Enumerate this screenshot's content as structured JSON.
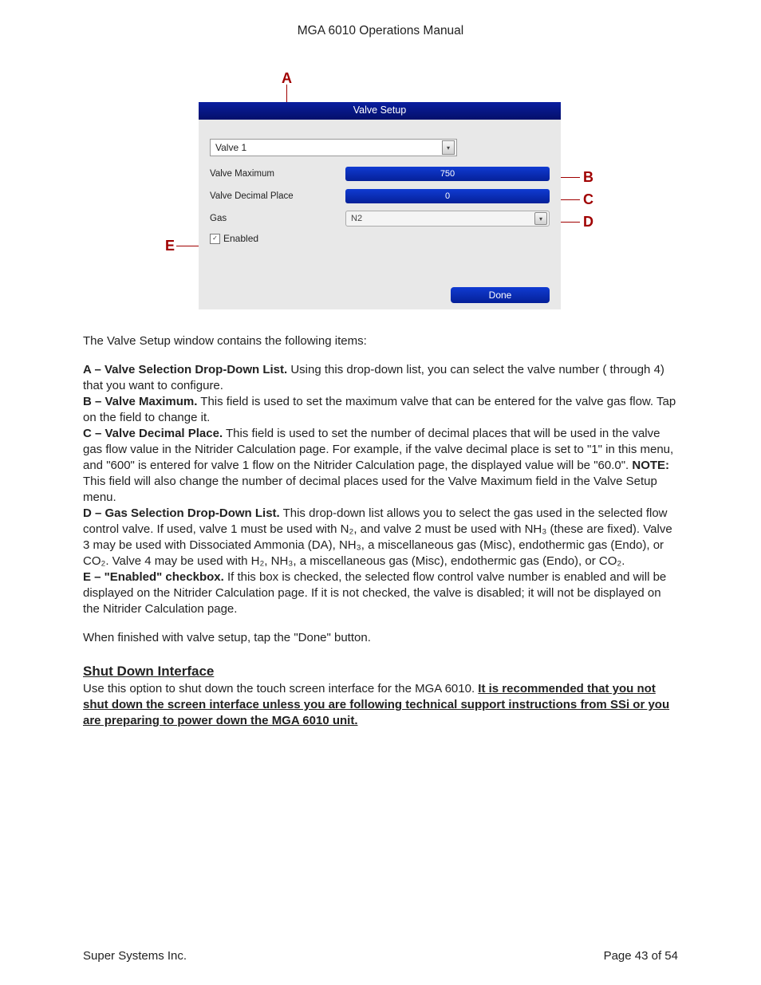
{
  "header": {
    "title": "MGA 6010 Operations Manual"
  },
  "annotations": {
    "A": "A",
    "B": "B",
    "C": "C",
    "D": "D",
    "E": "E"
  },
  "valve_setup": {
    "title": "Valve Setup",
    "selected_valve": "Valve 1",
    "fields": {
      "max_label": "Valve Maximum",
      "max_value": "750",
      "decimal_label": "Valve Decimal Place",
      "decimal_value": "0",
      "gas_label": "Gas",
      "gas_value": "N2"
    },
    "enabled_label": "Enabled",
    "done_label": "Done"
  },
  "paragraphs": {
    "intro": "The Valve Setup window contains the following items:",
    "A_head": "A – Valve Selection Drop-Down List.",
    "A_body": " Using this drop-down list, you can select the valve number ( through 4) that you want to configure.",
    "B_head": "B – Valve Maximum.",
    "B_body": " This field is used to set the maximum valve that can be entered for the valve gas flow. Tap on the field to change it.",
    "C_head": "C – Valve Decimal Place.",
    "C_body_1": " This field is used to set the number of decimal places that will be used in the valve gas flow value in the Nitrider Calculation page. For example, if the valve decimal place is set to \"1\" in this menu, and \"600\" is entered for valve 1 flow on the Nitrider Calculation page, the displayed value will be \"60.0\". ",
    "C_note": "NOTE:",
    "C_body_2": " This field will also change the number of decimal places used for the Valve Maximum field in the Valve Setup menu.",
    "D_head": "D – Gas Selection Drop-Down List.",
    "D_body": " This drop-down list allows you to select the gas used in the selected flow control valve. If used, valve 1 must be used with N₂, and valve 2 must be used with NH₃ (these are fixed). Valve 3 may be used with Dissociated Ammonia (DA), NH₃, a miscellaneous gas (Misc), endothermic gas (Endo), or CO₂. Valve 4 may be used with H₂, NH₃, a miscellaneous gas (Misc), endothermic gas (Endo), or CO₂.",
    "E_head": "E – \"Enabled\" checkbox.",
    "E_body": " If this box is checked, the selected flow control valve number is enabled and will be displayed on the Nitrider Calculation page. If it is not checked, the valve is disabled; it will not be displayed on the Nitrider Calculation page.",
    "finish": "When finished with valve setup, tap the \"Done\" button."
  },
  "shutdown": {
    "header": "Shut Down Interface",
    "text_1": "Use this option to shut down the touch screen interface for the MGA 6010. ",
    "text_2": "It is recommended that you not shut down the screen interface unless you are following technical support instructions from SSi or you are preparing to power down the MGA 6010 unit."
  },
  "footer": {
    "company": "Super Systems Inc.",
    "page": "Page 43 of 54"
  }
}
